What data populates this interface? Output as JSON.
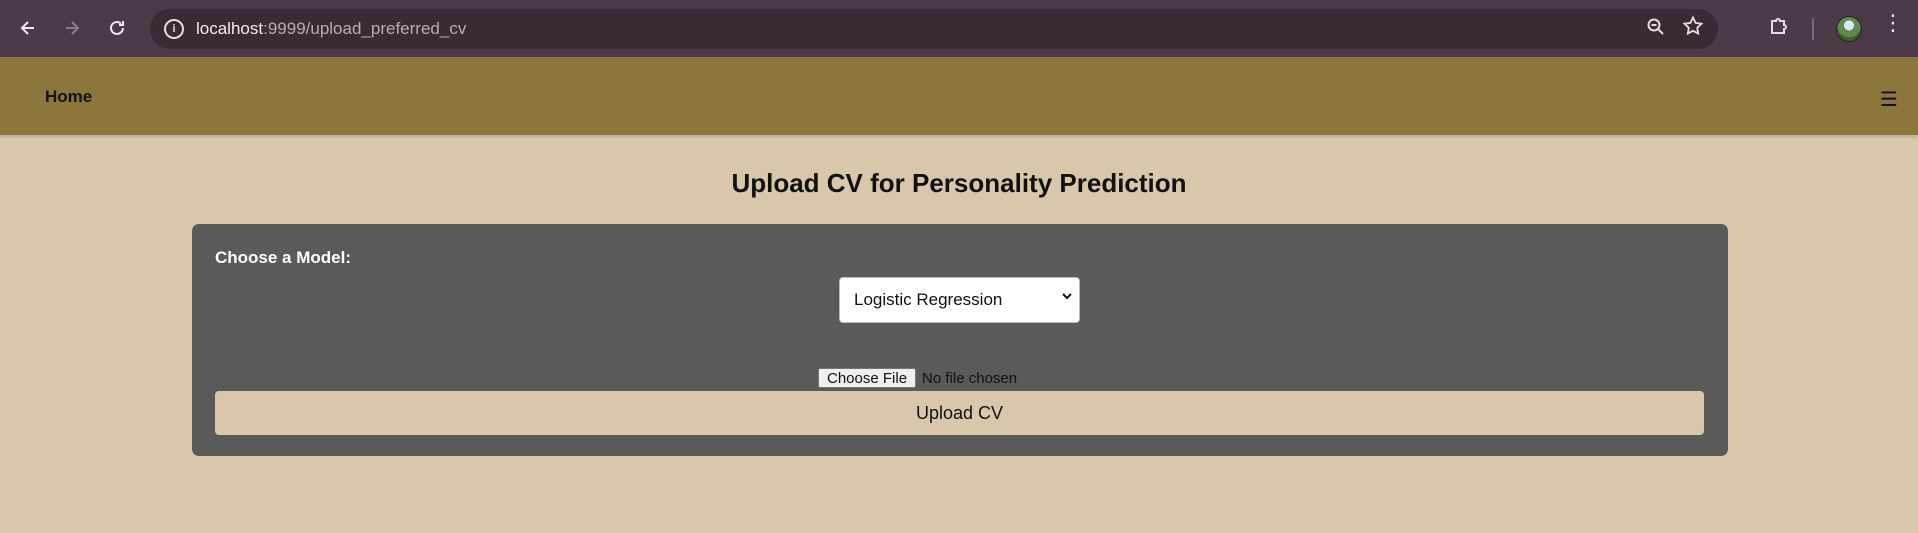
{
  "browser": {
    "url_host": "localhost",
    "url_path": ":9999/upload_preferred_cv",
    "icons": [
      "back-arrow-icon",
      "forward-arrow-icon",
      "reload-icon",
      "site-info-icon",
      "zoom-icon",
      "bookmark-star-icon",
      "extensions-icon",
      "profile-avatar",
      "more-menu-icon"
    ]
  },
  "navbar": {
    "home_label": "Home",
    "menu_glyph": "☰",
    "bg_color": "#8c763c"
  },
  "page": {
    "title": "Upload CV for Personality Prediction",
    "bg_color": "#d8c7ab"
  },
  "form": {
    "model_label": "Choose a Model:",
    "model_selected": "Logistic Regression",
    "choose_file_label": "Choose File",
    "file_status": "No file chosen",
    "upload_label": "Upload CV",
    "card_color": "#5a5a5a"
  }
}
